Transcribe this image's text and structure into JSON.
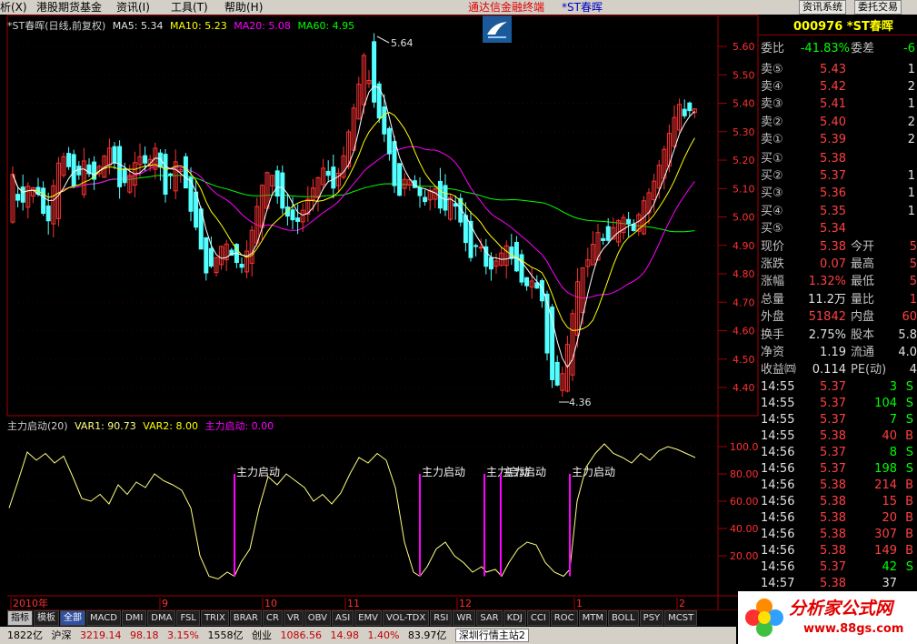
{
  "menu": {
    "items": [
      "析(X)",
      "港股期货基金",
      "资讯(I)",
      "工具(T)",
      "帮助(H)"
    ],
    "title": "通达信金融终端",
    "subtitle": "*ST春晖",
    "buttons": [
      "资讯系统",
      "委托交易"
    ]
  },
  "main_chart": {
    "legend": {
      "name": "*ST春晖(日线,前复权)",
      "ma5": "MA5: 5.34",
      "ma10": "MA10: 5.23",
      "ma20": "MA20: 5.08",
      "ma60": "MA60: 4.95"
    },
    "high_label": "5.64",
    "low_label": "4.36",
    "y_ticks": [
      "5.60",
      "5.50",
      "5.40",
      "5.30",
      "5.20",
      "5.10",
      "5.00",
      "4.90",
      "4.80",
      "4.70",
      "4.60",
      "4.50",
      "4.40"
    ],
    "colors": {
      "up": "#ff3232",
      "down": "#54ffff",
      "ma5": "#ffffff",
      "ma10": "#ffff00",
      "ma20": "#ff00ff",
      "ma60": "#00ff00"
    }
  },
  "indicator": {
    "legend": {
      "name": "主力启动(20)",
      "var1": "VAR1: 90.73",
      "var2": "VAR2: 8.00",
      "sig": "主力启动: 0.00"
    },
    "signal_label": "主力启动",
    "y_ticks": [
      "100.00",
      "80.00",
      "60.00",
      "40.00",
      "20.00"
    ]
  },
  "x_axis": {
    "labels": [
      "2010年",
      "9",
      "10",
      "11",
      "12",
      "1",
      "2"
    ]
  },
  "tabs": [
    "指标",
    "模板",
    "全部",
    "MACD",
    "DMI",
    "DMA",
    "FSL",
    "TRIX",
    "BRAR",
    "CR",
    "VR",
    "OBV",
    "ASI",
    "EMV",
    "VOL-TDX",
    "RSI",
    "WR",
    "SAR",
    "KDJ",
    "CCI",
    "ROC",
    "MTM",
    "BOLL",
    "PSY",
    "MCST"
  ],
  "status_bar": [
    "1822亿",
    "沪深",
    "3219.14",
    "98.18",
    "3.15%",
    "1558亿",
    "创业",
    "1086.56",
    "14.98",
    "1.40%",
    "83.97亿",
    "深圳行情主站2"
  ],
  "quote": {
    "code": "000976 *ST春晖",
    "weibi_label": "委比",
    "weibi_val": "-41.83%",
    "weicha_label": "委差",
    "weicha_val": "-6",
    "sell": [
      {
        "label": "卖⑤",
        "price": "5.43",
        "vol": "1"
      },
      {
        "label": "卖④",
        "price": "5.42",
        "vol": "2"
      },
      {
        "label": "卖③",
        "price": "5.41",
        "vol": "1"
      },
      {
        "label": "卖②",
        "price": "5.40",
        "vol": "2"
      },
      {
        "label": "卖①",
        "price": "5.39",
        "vol": "2"
      }
    ],
    "buy": [
      {
        "label": "买①",
        "price": "5.38",
        "vol": ""
      },
      {
        "label": "买②",
        "price": "5.37",
        "vol": "1"
      },
      {
        "label": "买③",
        "price": "5.36",
        "vol": "1"
      },
      {
        "label": "买④",
        "price": "5.35",
        "vol": "1"
      },
      {
        "label": "买⑤",
        "price": "5.34",
        "vol": ""
      }
    ],
    "stats": [
      {
        "l1": "现价",
        "v1": "5.38",
        "l2": "今开",
        "v2": "5"
      },
      {
        "l1": "涨跌",
        "v1": "0.07",
        "l2": "最高",
        "v2": "5"
      },
      {
        "l1": "涨幅",
        "v1": "1.32%",
        "l2": "最低",
        "v2": "5"
      },
      {
        "l1": "总量",
        "v1": "11.2万",
        "l2": "量比",
        "v2": "1"
      },
      {
        "l1": "外盘",
        "v1": "51842",
        "l2": "内盘",
        "v2": "60"
      }
    ],
    "stats2": [
      {
        "l1": "换手",
        "v1": "2.75%",
        "l2": "股本",
        "v2": "5.8"
      },
      {
        "l1": "净资",
        "v1": "1.19",
        "l2": "流通",
        "v2": "4.0"
      },
      {
        "l1": "收益㈣",
        "v1": "0.114",
        "l2": "PE(动)",
        "v2": "4"
      }
    ],
    "ticks": [
      {
        "t": "14:55",
        "p": "5.37",
        "v": "3",
        "d": "S"
      },
      {
        "t": "14:55",
        "p": "5.37",
        "v": "104",
        "d": "S"
      },
      {
        "t": "14:55",
        "p": "5.37",
        "v": "7",
        "d": "S"
      },
      {
        "t": "14:55",
        "p": "5.38",
        "v": "40",
        "d": "B"
      },
      {
        "t": "14:56",
        "p": "5.37",
        "v": "8",
        "d": "S"
      },
      {
        "t": "14:56",
        "p": "5.37",
        "v": "198",
        "d": "S"
      },
      {
        "t": "14:56",
        "p": "5.38",
        "v": "214",
        "d": "B"
      },
      {
        "t": "14:56",
        "p": "5.38",
        "v": "15",
        "d": "B"
      },
      {
        "t": "14:56",
        "p": "5.38",
        "v": "20",
        "d": "B"
      },
      {
        "t": "14:56",
        "p": "5.38",
        "v": "307",
        "d": "B"
      },
      {
        "t": "14:56",
        "p": "5.38",
        "v": "149",
        "d": "B"
      },
      {
        "t": "14:56",
        "p": "5.37",
        "v": "42",
        "d": "S"
      },
      {
        "t": "14:57",
        "p": "5.38",
        "v": "37",
        "d": ""
      }
    ]
  },
  "ad": {
    "brand": "分析家公式网",
    "url": "www.88gs.com"
  }
}
